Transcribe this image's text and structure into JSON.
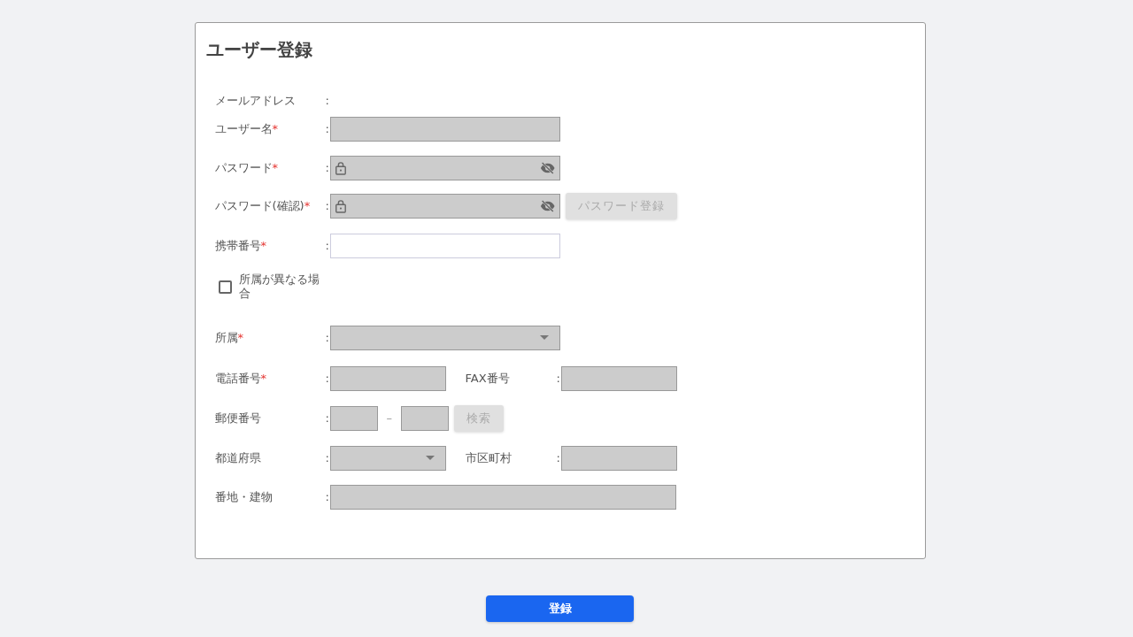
{
  "title": "ユーザー登録",
  "rows": [
    {
      "kind": "field",
      "label": "メールアドレス",
      "colon": ":"
    },
    {
      "kind": "field",
      "label": "ユーザー名",
      "mark": "*",
      "colon": ":",
      "controls": [
        {
          "kind": "text",
          "disabled": true
        }
      ]
    },
    {
      "kind": "field",
      "label": "パスワード",
      "mark": "*",
      "colon": ":",
      "controls": [
        {
          "kind": "password",
          "disabled": true
        }
      ]
    },
    {
      "kind": "field",
      "label": "パスワード(確認)",
      "mark": "*",
      "colon": ":",
      "controls": [
        {
          "kind": "password",
          "disabled": true
        },
        {
          "kind": "button",
          "text": "パスワード登録",
          "disabled": true
        }
      ]
    },
    {
      "kind": "field",
      "label": "携帯番号",
      "mark": "*",
      "colon": ":",
      "controls": [
        {
          "kind": "text",
          "disabled": false
        }
      ]
    },
    {
      "kind": "checkbox",
      "label": "所属が異なる場合",
      "checked": false
    },
    {
      "kind": "field",
      "label": "所属",
      "mark": "*",
      "colon": ":",
      "controls": [
        {
          "kind": "select",
          "disabled": true
        }
      ]
    },
    {
      "kind": "field",
      "label": "電話番号",
      "mark": "*",
      "colon": ":",
      "controls": [
        {
          "kind": "half",
          "disabled": true
        },
        {
          "kind": "sublabel",
          "text": "FAX番号",
          "colon": ":"
        },
        {
          "kind": "half",
          "disabled": true
        }
      ]
    },
    {
      "kind": "field",
      "label": "郵便番号",
      "colon": ":",
      "controls": [
        {
          "kind": "postal",
          "disabled": true
        },
        {
          "kind": "dash",
          "text": "–"
        },
        {
          "kind": "postal",
          "disabled": true
        },
        {
          "kind": "button",
          "text": "検索",
          "disabled": true
        }
      ]
    },
    {
      "kind": "field",
      "label": "都道府県",
      "colon": ":",
      "controls": [
        {
          "kind": "halfselect",
          "disabled": true
        },
        {
          "kind": "sublabel",
          "text": "市区町村",
          "colon": ":"
        },
        {
          "kind": "half",
          "disabled": true
        }
      ]
    },
    {
      "kind": "field",
      "label": "番地・建物",
      "colon": ":",
      "controls": [
        {
          "kind": "long",
          "disabled": true
        }
      ]
    }
  ],
  "submit": {
    "text": "登録",
    "disabled": false
  }
}
